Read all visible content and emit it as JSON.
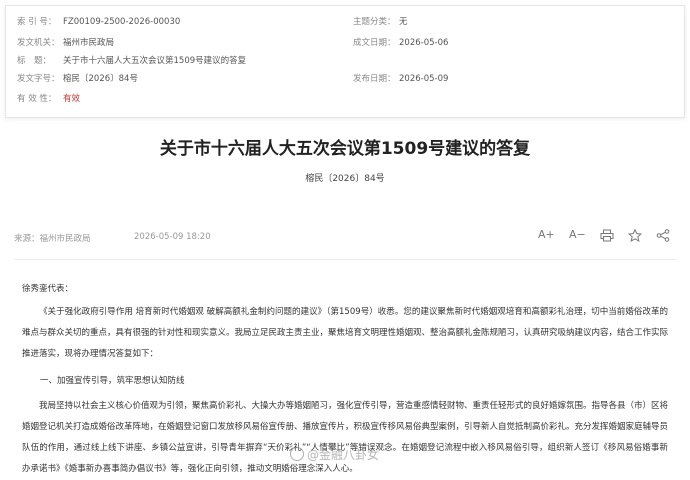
{
  "meta": {
    "index_label": "索 引 号：",
    "index_value": "FZ00109-2500-2026-00030",
    "subject_label": "主题分类：",
    "subject_value": "无",
    "issuer_label": "发文机关：",
    "issuer_value": "福州市民政局",
    "date_label": "成文日期：",
    "date_value": "2026-05-06",
    "title_label": "标　题：",
    "title_value": "关于市十六届人大五次会议第1509号建议的答复",
    "docno_label": "发文字号：",
    "docno_value": "榕民〔2026〕84号",
    "pubdate_label": "发布日期：",
    "pubdate_value": "2026-05-09",
    "validity_label": "有 效 性：",
    "validity_value": "有效"
  },
  "article": {
    "title": "关于市十六届人大五次会议第1509号建议的答复",
    "doc_number": "榕民〔2026〕84号",
    "source": "来源：福州市民政局",
    "datetime": "2026-05-09 18:20",
    "greeting": "徐秀銮代表：",
    "para1": "《关于强化政府引导作用 培育新时代婚姻观 破解高额礼金制约问题的建议》（第1509号）收悉。您的建议聚焦新时代婚姻观培育和高额彩礼治理，切中当前婚俗改革的难点与群众关切的重点，具有很强的针对性和现实意义。我局立足民政主责主业，聚焦培育文明理性婚姻观、整治高额礼金陈规陋习，认真研究吸纳建议内容，结合工作实际推进落实，现将办理情况答复如下：",
    "section1": "一、加强宣传引导，筑牢思想认知防线",
    "para2": "我局坚持以社会主义核心价值观为引领，聚焦高价彩礼、大操大办等婚姻陋习，强化宣传引导，营造重感情轻财物、重责任轻形式的良好婚嫁氛围。指导各县（市）区将婚姻登记机关打造成婚俗改革阵地，在婚姻登记窗口发放移风易俗宣传册、播放宣传片，积极宣传移风易俗典型案例，引导新人自觉抵制高价彩礼。充分发挥婚姻家庭辅导员队伍的作用，通过线上线下讲座、乡镇公益宣讲，引导青年摒弃“天价彩礼”“人情攀比”等错误观念。在婚姻登记流程中嵌入移风易俗引导，组织新人签订《移风易俗婚事新办承诺书》《婚事新办喜事简办倡议书》等，强化正向引领，推动文明婚俗理念深入人心。"
  },
  "toolbar": {
    "font_increase": "A+",
    "font_decrease": "A−"
  },
  "watermark": "@金融八卦女"
}
